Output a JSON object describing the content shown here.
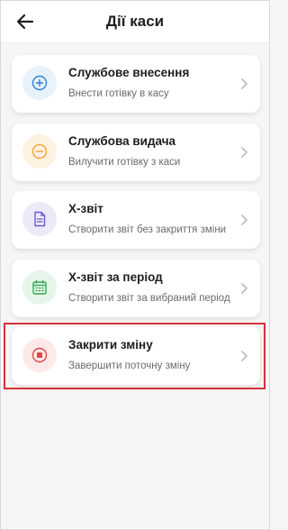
{
  "header": {
    "title": "Дії каси",
    "back_icon": "arrow-left-icon"
  },
  "actions": [
    {
      "id": "service-deposit",
      "title": "Службове внесення",
      "subtitle": "Внести готівку в касу",
      "icon": "plus-circle-icon",
      "icon_bg": "#e8f2fd",
      "icon_color": "#2f7fd8"
    },
    {
      "id": "service-withdrawal",
      "title": "Службова видача",
      "subtitle": "Вилучити готівку з каси",
      "icon": "minus-circle-icon",
      "icon_bg": "#fdf1e2",
      "icon_color": "#f0a43a"
    },
    {
      "id": "x-report",
      "title": "Х-звіт",
      "subtitle": "Створити звіт без закриття зміни",
      "icon": "document-icon",
      "icon_bg": "#eceaf9",
      "icon_color": "#6a5fc9"
    },
    {
      "id": "x-report-period",
      "title": "Х-звіт за період",
      "subtitle": "Створити звіт за вибраний період",
      "icon": "calendar-icon",
      "icon_bg": "#e6f5ea",
      "icon_color": "#3aa756"
    },
    {
      "id": "close-shift",
      "title": "Закрити зміну",
      "subtitle": "Завершити поточну зміну",
      "icon": "stop-circle-icon",
      "icon_bg": "#fde9ea",
      "icon_color": "#e04646"
    }
  ],
  "colors": {
    "highlight": "#d4323a",
    "chevron": "#bdbdbd"
  }
}
